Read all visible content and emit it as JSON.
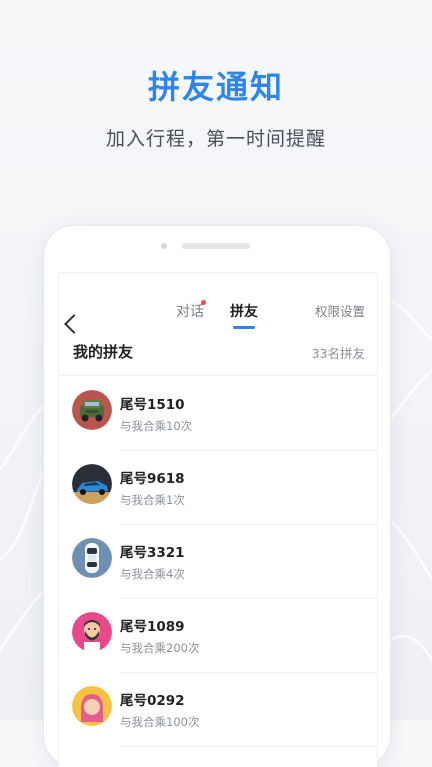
{
  "hero": {
    "title": "拼友通知",
    "subtitle": "加入行程，第一时间提醒"
  },
  "nav": {
    "tabs": [
      {
        "label": "对话",
        "has_unread_dot": true
      },
      {
        "label": "拼友",
        "active": true
      }
    ],
    "settings_label": "权限设置"
  },
  "section": {
    "title": "我的拼友",
    "count": "33名拼友"
  },
  "friends": [
    {
      "name": "尾号1510",
      "rides": "与我合乘10次",
      "avatar": "green-jeep-avatar"
    },
    {
      "name": "尾号9618",
      "rides": "与我合乘1次",
      "avatar": "blue-sportscar-avatar"
    },
    {
      "name": "尾号3321",
      "rides": "与我合乘4次",
      "avatar": "white-car-topview-avatar"
    },
    {
      "name": "尾号1089",
      "rides": "与我合乘200次",
      "avatar": "bearded-man-avatar"
    },
    {
      "name": "尾号0292",
      "rides": "与我合乘100次",
      "avatar": "pink-hair-girl-avatar"
    }
  ],
  "colors": {
    "accent": "#2f86ea",
    "unread_dot": "#ee4c4c",
    "text_primary": "#222222",
    "text_secondary": "#8b9098"
  }
}
